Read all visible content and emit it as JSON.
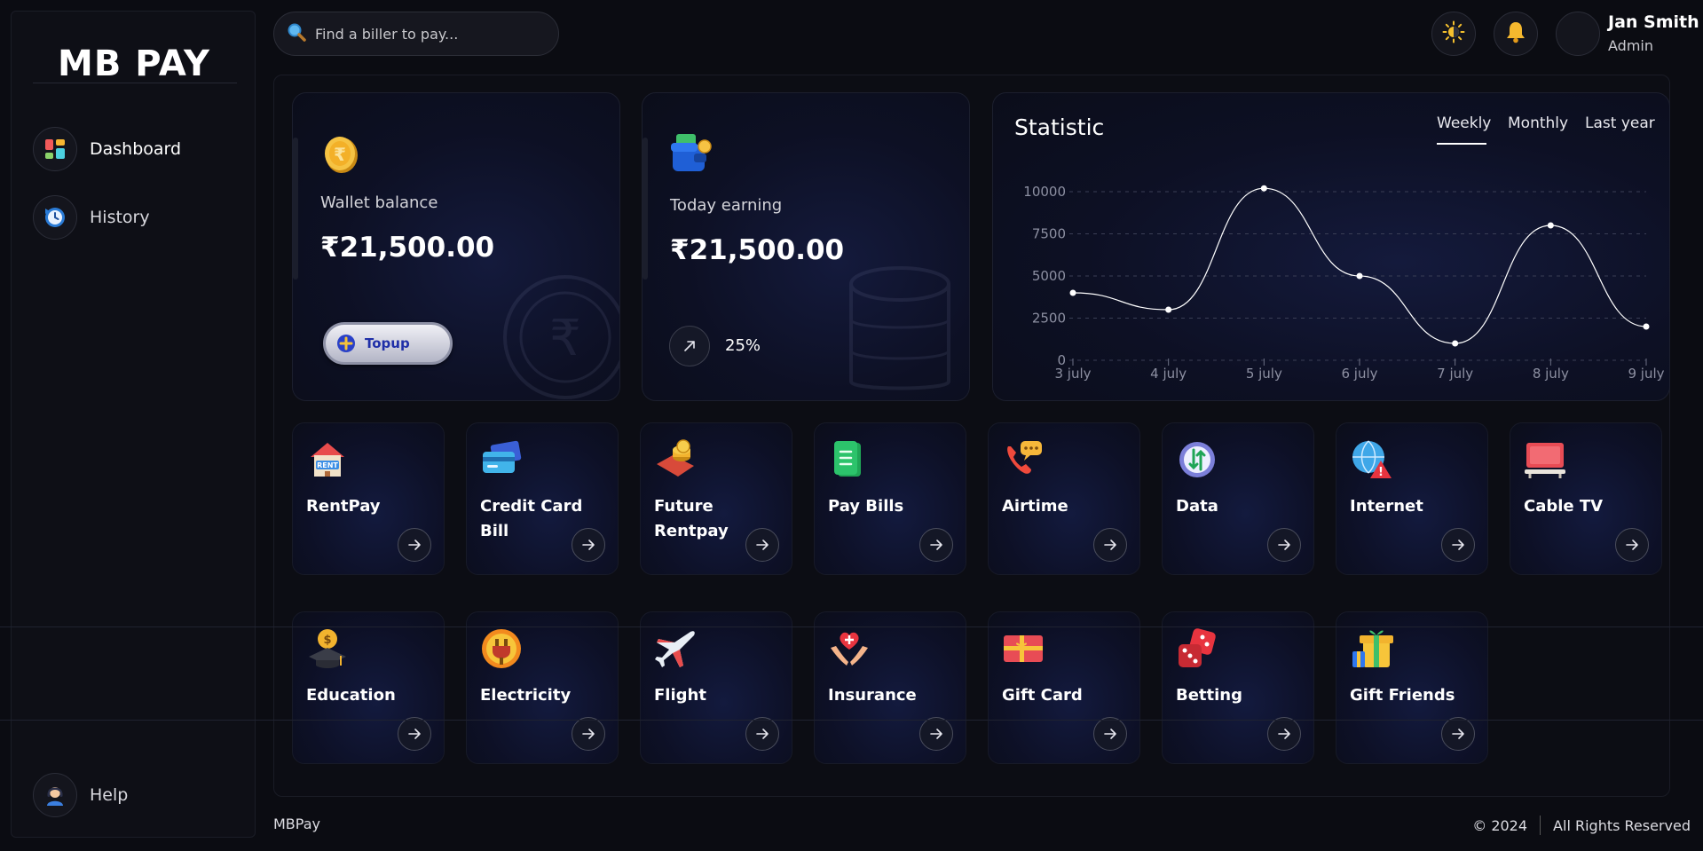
{
  "app": {
    "logo": "MB PAY"
  },
  "sidebar": {
    "items": [
      {
        "label": "Dashboard",
        "icon": "dashboard-grid-icon"
      },
      {
        "label": "History",
        "icon": "history-clock-icon"
      }
    ],
    "help": {
      "label": "Help",
      "icon": "support-agent-icon"
    }
  },
  "search": {
    "placeholder": "Find a biller to pay..."
  },
  "header": {
    "theme_icon": "sun-icon",
    "notification_icon": "bell-icon",
    "user": {
      "name": "Jan Smith",
      "role": "Admin"
    }
  },
  "wallet": {
    "label": "Wallet balance",
    "amount": "₹21,500.00",
    "topup_label": "Topup",
    "icon": "rupee-coin-icon"
  },
  "earning": {
    "label": "Today earning",
    "amount": "₹21,500.00",
    "change": "25%",
    "icon": "wallet-icon"
  },
  "statistic": {
    "title": "Statistic",
    "tabs": [
      "Weekly",
      "Monthly",
      "Last year"
    ],
    "active_tab": "Weekly"
  },
  "chart_data": {
    "type": "line",
    "categories": [
      "3 july",
      "4 july",
      "5 july",
      "6 july",
      "7 july",
      "8 july",
      "9 july"
    ],
    "values": [
      4000,
      3000,
      10200,
      5000,
      1000,
      8000,
      2000
    ],
    "yticks": [
      0,
      2500,
      5000,
      7500,
      10000
    ],
    "ylim": [
      0,
      10000
    ],
    "grid": true,
    "line_color": "#ffffff"
  },
  "services": {
    "row1": [
      {
        "name": "RentPay",
        "icon": "rent-house-icon"
      },
      {
        "name": "Credit Card Bill",
        "icon": "credit-card-icon"
      },
      {
        "name": "Future Rentpay",
        "icon": "coins-icon"
      },
      {
        "name": "Pay Bills",
        "icon": "bill-receipt-icon"
      },
      {
        "name": "Airtime",
        "icon": "phone-chat-icon"
      },
      {
        "name": "Data",
        "icon": "data-arrows-icon"
      },
      {
        "name": "Internet",
        "icon": "globe-alert-icon"
      },
      {
        "name": "Cable TV",
        "icon": "tv-icon"
      }
    ],
    "row2": [
      {
        "name": "Education",
        "icon": "graduation-cap-icon"
      },
      {
        "name": "Electricity",
        "icon": "plug-icon"
      },
      {
        "name": "Flight",
        "icon": "airplane-icon"
      },
      {
        "name": "Insurance",
        "icon": "hands-heart-icon"
      },
      {
        "name": "Gift Card",
        "icon": "gift-card-icon"
      },
      {
        "name": "Betting",
        "icon": "dice-icon"
      },
      {
        "name": "Gift Friends",
        "icon": "gift-box-icon"
      }
    ]
  },
  "footer": {
    "left": "MBPay",
    "copyright": "© 2024",
    "rights": "All Rights Reserved"
  }
}
